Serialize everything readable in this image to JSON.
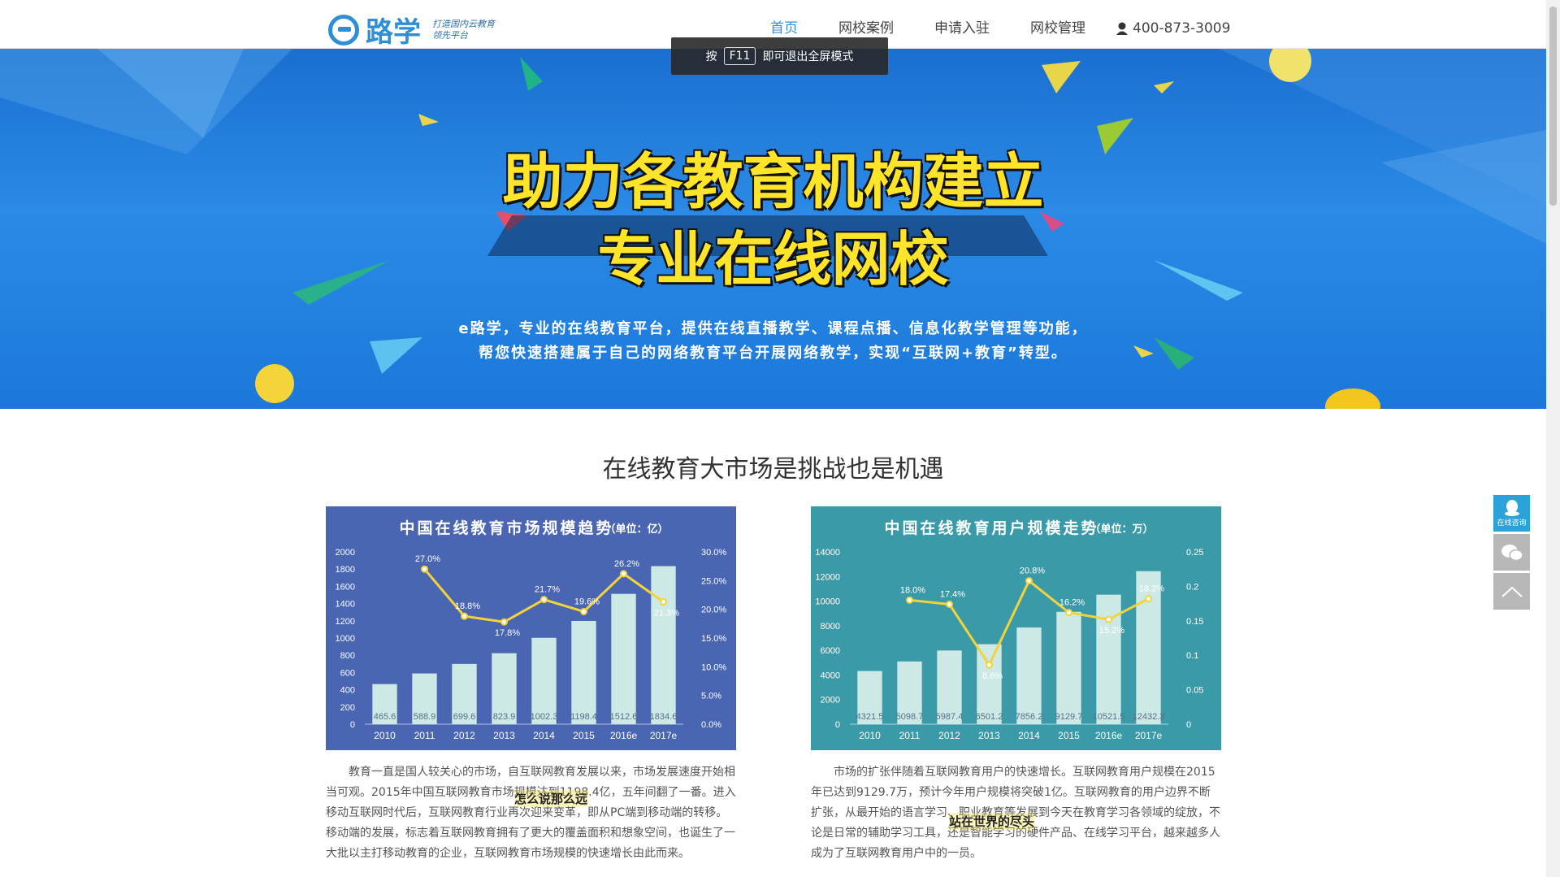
{
  "header": {
    "logo_text": "路学",
    "logo_slogan_1": "打造国内云教育",
    "logo_slogan_2": "领先平台",
    "nav": [
      "首页",
      "网校案例",
      "申请入驻",
      "网校管理"
    ],
    "phone": "400-873-3009"
  },
  "toast": {
    "prefix": "按",
    "key": "F11",
    "suffix": "即可退出全屏模式"
  },
  "banner": {
    "title_1": "助力各教育机构建立",
    "title_2": "专业在线网校",
    "desc_1": "e路学，专业的在线教育平台，提供在线直播教学、课程点播、信息化教学管理等功能，",
    "desc_2": "帮您快速搭建属于自己的网络教育平台开展网络教学，实现“互联网+教育”转型。"
  },
  "section": {
    "title": "在线教育大市场是挑战也是机遇"
  },
  "paragraphs": {
    "left": "教育一直是国人较关心的市场，自互联网教育发展以来，市场发展速度开始相当可观。2015年中国互联网教育市场规模达到1198.4亿，五年间翻了一番。进入移动互联网时代后，互联网教育行业再次迎来变革，即从PC端到移动端的转移。移动端的发展，标志着互联网教育拥有了更大的覆盖面积和想象空间，也诞生了一大批以主打移动教育的企业，互联网教育市场规模的快速增长由此而来。",
    "right": "市场的扩张伴随着互联网教育用户的快速增长。互联网教育用户规模在2015年已达到9129.7万，预计今年用户规模将突破1亿。互联网教育的用户边界不断扩张，从最开始的语言学习、职业教育等发展到今天在教育学习各领域的绽放，不论是日常的辅助学习工具，还是智能学习的硬件产品、在线学习平台，越来越多人成为了互联网教育用户中的一员。",
    "overlay_left": "怎么说那么远",
    "overlay_right": "站在世界的尽头"
  },
  "sidebar": {
    "qq_label": "在线咨询"
  },
  "colors": {
    "accent": "#2f8fd6",
    "bar": "#cde9e6",
    "line": "#f2d43a"
  },
  "chart_data": [
    {
      "type": "bar",
      "title": "中国在线教育市场规模趋势",
      "unit": "（单位：亿）",
      "categories": [
        "2010",
        "2011",
        "2012",
        "2013",
        "2014",
        "2015",
        "2016e",
        "2017e"
      ],
      "series": [
        {
          "values": [
            465.6,
            588.9,
            699.6,
            823.9,
            1002.3,
            1198.4,
            1512.6,
            1834.6
          ]
        },
        {
          "values": [
            null,
            27.0,
            18.8,
            17.8,
            21.7,
            19.6,
            26.2,
            21.3
          ]
        }
      ],
      "value_labels": [
        "465.6",
        "588.9",
        "699.6",
        "823.9",
        "1002.3",
        "1198.4",
        "1512.6",
        "1834.6"
      ],
      "rate_labels": [
        "",
        "27.0%",
        "18.8%",
        "17.8%",
        "21.7%",
        "19.6%",
        "26.2%",
        "21.3%"
      ],
      "ylim": [
        0,
        2000
      ],
      "yticks": [
        "0",
        "200",
        "400",
        "600",
        "800",
        "1000",
        "1200",
        "1400",
        "1600",
        "1800",
        "2000"
      ],
      "y2lim": [
        0,
        30
      ],
      "y2ticks": [
        "0.0%",
        "5.0%",
        "10.0%",
        "15.0%",
        "20.0%",
        "25.0%",
        "30.0%"
      ]
    },
    {
      "type": "bar",
      "title": "中国在线教育用户规模走势",
      "unit": "（单位：万）",
      "categories": [
        "2010",
        "2011",
        "2012",
        "2013",
        "2014",
        "2015",
        "2016e",
        "2017e"
      ],
      "series": [
        {
          "values": [
            4321.5,
            5098.7,
            5987.4,
            6501.2,
            7856.2,
            9129.7,
            10521.5,
            12432.3
          ]
        },
        {
          "values": [
            null,
            0.18,
            0.174,
            0.086,
            0.208,
            0.162,
            0.152,
            0.182
          ]
        }
      ],
      "value_labels": [
        "4321.5",
        "5098.7",
        "5987.4",
        "6501.2",
        "7856.2",
        "9129.7",
        "10521.5",
        "12432.3"
      ],
      "rate_labels": [
        "",
        "18.0%",
        "17.4%",
        "8.6%",
        "20.8%",
        "16.2%",
        "15.2%",
        "18.2%"
      ],
      "ylim": [
        0,
        14000
      ],
      "yticks": [
        "0",
        "2000",
        "4000",
        "6000",
        "8000",
        "10000",
        "12000",
        "14000"
      ],
      "y2lim": [
        0,
        0.25
      ],
      "y2ticks": [
        "0",
        "0.05",
        "0.1",
        "0.15",
        "0.2",
        "0.25"
      ]
    }
  ]
}
